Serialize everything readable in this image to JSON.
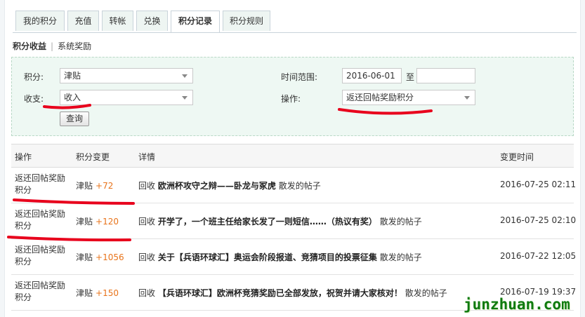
{
  "tabs": [
    {
      "label": "我的积分"
    },
    {
      "label": "充值"
    },
    {
      "label": "转帐"
    },
    {
      "label": "兑换"
    },
    {
      "label": "积分记录",
      "active": true
    },
    {
      "label": "积分规则"
    }
  ],
  "subnav": {
    "item1": "积分收益",
    "item2": "系统奖励"
  },
  "filter": {
    "points_label": "积分:",
    "points_value": "津贴",
    "income_label": "收支:",
    "income_value": "收入",
    "time_label": "时间范围:",
    "time_from": "2016-06-01",
    "time_to_label": "至",
    "time_to": "",
    "op_label": "操作:",
    "op_value": "返还回帖奖励积分",
    "query_button": "查询"
  },
  "table": {
    "headers": [
      "操作",
      "积分变更",
      "详情",
      "变更时间"
    ],
    "rows": [
      {
        "op": "返还回帖奖励积分",
        "currency": "津贴",
        "delta": "+72",
        "prefix": "回收",
        "title": "欧洲杯攻守之辩——卧龙与冢虎",
        "suffix": "散发的帖子",
        "time": "2016-07-25 02:11"
      },
      {
        "op": "返还回帖奖励积分",
        "currency": "津贴",
        "delta": "+120",
        "prefix": "回收",
        "title": "开学了，一个班主任给家长发了一则短信……（热议有奖）",
        "suffix": "散发的帖子",
        "time": "2016-07-25 02:10"
      },
      {
        "op": "返还回帖奖励积分",
        "currency": "津贴",
        "delta": "+1056",
        "prefix": "回收",
        "title": "关于【兵语环球汇】奥运会阶段报道、竞猜项目的投票征集",
        "suffix": "散发的帖子",
        "time": "2016-07-22 12:05"
      },
      {
        "op": "返还回帖奖励积分",
        "currency": "津贴",
        "delta": "+150",
        "prefix": "回收",
        "title": "【兵语环球汇】欧洲杯竞猜奖励已全部发放，祝贺并请大家核对！",
        "suffix": "散发的帖子",
        "time": "2016-07-19 19:37"
      }
    ]
  },
  "watermark": "junzhuan.com",
  "colors": {
    "accent_orange": "#e8731a",
    "annotation_red": "#e8001c",
    "filter_bg": "#eef8f3",
    "watermark_green": "#0f7a0f"
  }
}
